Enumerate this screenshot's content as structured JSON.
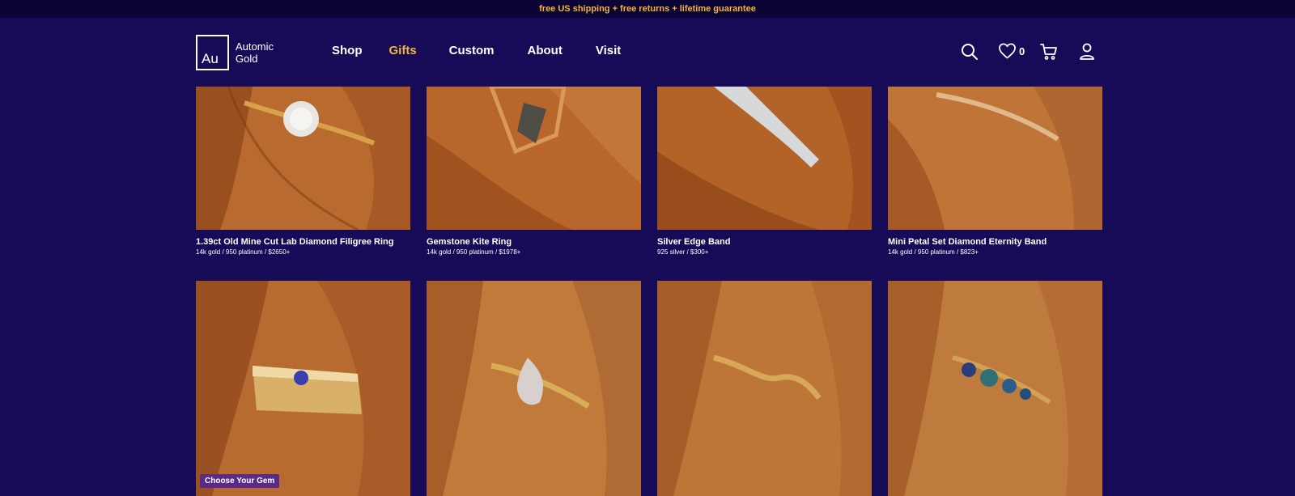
{
  "promo": {
    "text": "free US shipping + free returns + lifetime guarantee"
  },
  "brand": {
    "mark": "Au",
    "name_line1": "Automic",
    "name_line2": "Gold"
  },
  "nav": {
    "items": [
      {
        "label": "Shop",
        "active": false
      },
      {
        "label": "Gifts",
        "active": true
      },
      {
        "label": "Custom",
        "active": false
      },
      {
        "label": "About",
        "active": false
      },
      {
        "label": "Visit",
        "active": false
      }
    ]
  },
  "header_icons": {
    "search": "search-icon",
    "wishlist": "heart-icon",
    "wishlist_count": "0",
    "cart": "cart-icon",
    "account": "user-icon"
  },
  "colors": {
    "background": "#170a57",
    "promo_bar": "#0b0434",
    "accent": "#f2b63b",
    "badge": "#5a2a86"
  },
  "products": [
    {
      "title": "1.39ct Old Mine Cut Lab Diamond Filigree Ring",
      "meta": "14k gold  / 950 platinum  /  $2650+"
    },
    {
      "title": "Gemstone Kite Ring",
      "meta": "14k gold  / 950 platinum  /  $1978+"
    },
    {
      "title": "Silver Edge Band",
      "meta": "925 silver  /  $300+"
    },
    {
      "title": "Mini Petal Set Diamond Eternity Band",
      "meta": "14k gold  / 950 platinum  /  $823+"
    },
    {
      "title": "",
      "meta": "",
      "badge": "Choose Your Gem"
    },
    {
      "title": "",
      "meta": ""
    },
    {
      "title": "",
      "meta": ""
    },
    {
      "title": "",
      "meta": ""
    }
  ]
}
